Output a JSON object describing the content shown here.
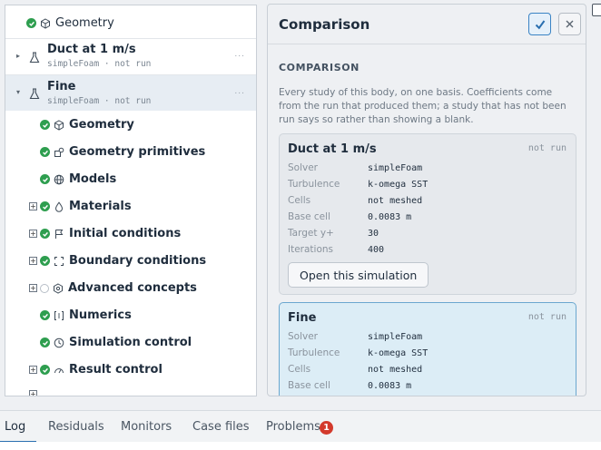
{
  "tree": {
    "top_item": {
      "label": "Geometry",
      "icon": "cube-icon"
    },
    "simulations": [
      {
        "title": "Duct at 1 m/s",
        "subtitle": "simpleFoam · not run",
        "more": "..."
      },
      {
        "title": "Fine",
        "subtitle": "simpleFoam · not run",
        "more": "..."
      }
    ],
    "items": [
      {
        "label": "Geometry",
        "status": "ok",
        "expandable": false,
        "icon": "cube-icon"
      },
      {
        "label": "Geometry primitives",
        "status": "ok",
        "expandable": false,
        "icon": "shapes-icon"
      },
      {
        "label": "Models",
        "status": "ok",
        "expandable": false,
        "icon": "globe-icon"
      },
      {
        "label": "Materials",
        "status": "ok",
        "expandable": true,
        "icon": "drop-icon"
      },
      {
        "label": "Initial conditions",
        "status": "ok",
        "expandable": true,
        "icon": "flag-icon"
      },
      {
        "label": "Boundary conditions",
        "status": "ok",
        "expandable": true,
        "icon": "boundary-icon"
      },
      {
        "label": "Advanced concepts",
        "status": "pending",
        "expandable": true,
        "icon": "hexagon-icon"
      },
      {
        "label": "Numerics",
        "status": "ok",
        "expandable": false,
        "icon": "numerics-icon"
      },
      {
        "label": "Simulation control",
        "status": "ok",
        "expandable": false,
        "icon": "clock-icon"
      },
      {
        "label": "Result control",
        "status": "ok",
        "expandable": true,
        "icon": "gauge-icon"
      }
    ]
  },
  "comparison": {
    "title": "Comparison",
    "section_title": "COMPARISON",
    "description": "Every study of this body, on one basis. Coefficients come from the run that produced them; a study that has not been run says so rather than showing a blank.",
    "cards": [
      {
        "name": "Duct at 1 m/s",
        "status": "not run",
        "rows": [
          {
            "k": "Solver",
            "v": "simpleFoam"
          },
          {
            "k": "Turbulence",
            "v": "k-omega SST"
          },
          {
            "k": "Cells",
            "v": "not meshed"
          },
          {
            "k": "Base cell",
            "v": "0.0083 m"
          },
          {
            "k": "Target y+",
            "v": "30"
          },
          {
            "k": "Iterations",
            "v": "400"
          }
        ],
        "button": "Open this simulation"
      },
      {
        "name": "Fine",
        "status": "not run",
        "rows": [
          {
            "k": "Solver",
            "v": "simpleFoam"
          },
          {
            "k": "Turbulence",
            "v": "k-omega SST"
          },
          {
            "k": "Cells",
            "v": "not meshed"
          },
          {
            "k": "Base cell",
            "v": "0.0083 m"
          }
        ]
      }
    ]
  },
  "bottom_tabs": {
    "tabs": [
      "Log",
      "Residuals",
      "Monitors",
      "Case files",
      "Problems"
    ],
    "active": "Log",
    "problems_count": "1"
  },
  "colors": {
    "ok": "#2e9e4f",
    "accent": "#2a6fb0",
    "badge": "#d33a2c"
  }
}
